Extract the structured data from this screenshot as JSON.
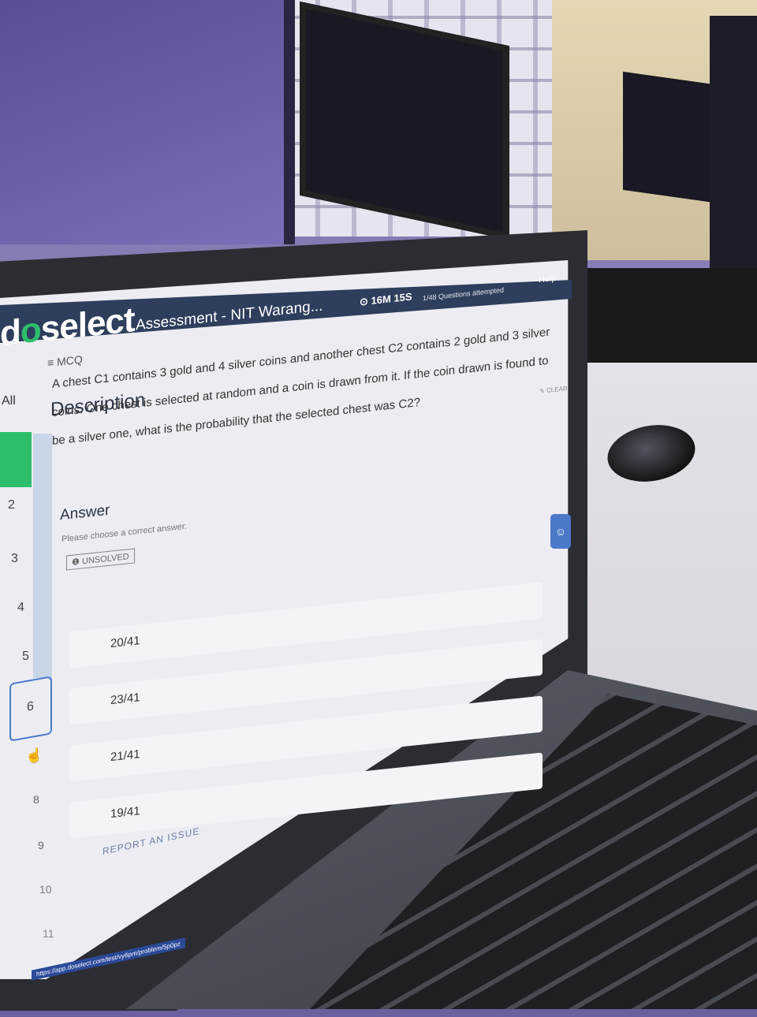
{
  "header": {
    "logo": {
      "prefix": "d",
      "mark": "o",
      "suffix": "select"
    },
    "title": "Assessment - NIT Warang...",
    "timer": "16M 15S",
    "attempted": "1/48 Questions attempted",
    "help": "Help"
  },
  "nav": {
    "mcq": "MCQ",
    "all": "All",
    "numbers": [
      "2",
      "3",
      "4",
      "5",
      "6",
      "8",
      "9",
      "10",
      "11"
    ]
  },
  "description": {
    "title": "Description",
    "clear": "CLEAR",
    "question": "A chest C1 contains 3 gold and 4 silver coins and another chest C2 contains 2 gold and 3 silver coins. One chest is selected at random and a coin is drawn from it. If the coin drawn is found to be a silver one, what is the probability that the selected chest was C2?"
  },
  "answer": {
    "label": "Answer",
    "hint": "Please choose a correct answer.",
    "status": "UNSOLVED",
    "options": [
      "20/41",
      "23/41",
      "21/41",
      "19/41"
    ]
  },
  "report": "REPORT AN ISSUE",
  "url": "https://app.doselect.com/test/vy6pm/problem/5p0pz"
}
